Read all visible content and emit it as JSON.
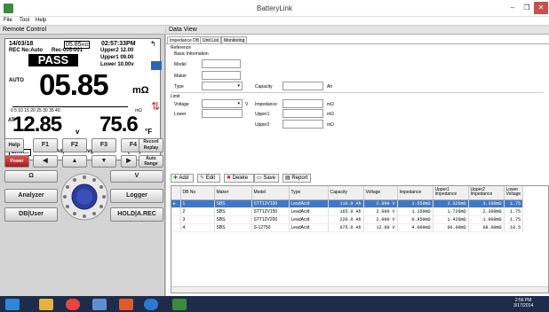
{
  "window": {
    "title": "BatteryLink",
    "min": "–",
    "max": "❐",
    "close": "✕"
  },
  "menu": [
    "File",
    "Tool",
    "Help"
  ],
  "left_header": "Remote Control",
  "right_header": "Data View",
  "lcd": {
    "date": "14/03/18",
    "range": "05.85",
    "range_unit": "mΩ",
    "time": "02:57:33PM",
    "rec": "REC No:Auto",
    "rec_num": "Rec-005-001",
    "pass": "PASS",
    "upper2": "Upper2 12.00",
    "upper1": "Upper1 09.00",
    "lower": "Lower 10.00v",
    "auto": "AUTO",
    "main_value": "05.85",
    "main_unit": "mΩ",
    "scale_labels": "0  5  10  15  20  25  30  35  40",
    "scale_unit": "mΩ",
    "at": "AT",
    "voltage": "12.85",
    "voltage_unit": "v",
    "temp": "75.6",
    "temp_unit": "°F",
    "bottom": [
      "Limit...",
      "0 Adj",
      "Avg Clear",
      "[Mm]Ω"
    ]
  },
  "buttons": {
    "help": "Help",
    "f1": "F1",
    "f2": "F2",
    "f3": "F3",
    "f4": "F4",
    "record": "Record\nReplay",
    "power": "Power",
    "auto_range": "Auto\nRange",
    "ohm": "Ω",
    "volt": "V",
    "analyzer": "Analyzer",
    "logger": "Logger",
    "db_user": "DB|User",
    "hold": "HOLD|A.REC"
  },
  "tabs": [
    "Impedance DB",
    "Unit List",
    "Monitoring"
  ],
  "form": {
    "reference": "Reference",
    "basic": "Basic Information",
    "model": "Model",
    "maker": "Maker",
    "type": "Type",
    "capacity": "Capacity",
    "capacity_unit": "Ah",
    "limit": "Limit",
    "voltage": "Voltage",
    "voltage_unit": "V",
    "lower": "Lower",
    "impedance": "Impedance",
    "upper1": "Upper1",
    "upper2": "Upper2",
    "mohm": "mΩ"
  },
  "toolbar": [
    "Add",
    "Edit",
    "Delete",
    "Save",
    "Report"
  ],
  "table": {
    "columns": [
      "",
      "DB No",
      "Maker",
      "Model",
      "Type",
      "Capacity",
      "Voltage",
      "Impedance",
      "Upper1\nImpedance",
      "Upper2\nImpedance",
      "Lower\nVoltage"
    ],
    "rows": [
      [
        "▸",
        "1",
        "SBS",
        "STT12V100",
        "LeadAcid",
        "110.0 Ah",
        "2.000 V",
        "1.550mΩ",
        "2.326mΩ",
        "3.100mΩ",
        "1.75"
      ],
      [
        "",
        "2",
        "SBS",
        "STT12V150",
        "LeadAcid",
        "165.0 Ah",
        "2.000 V",
        "1.150mΩ",
        "1.726mΩ",
        "2.300mΩ",
        "1.75"
      ],
      [
        "",
        "3",
        "SBS",
        "STT12V200",
        "LeadAcid",
        "220.0 Ah",
        "2.000 V",
        "0.950mΩ",
        "1.426mΩ",
        "1.900mΩ",
        "1.75"
      ],
      [
        "",
        "4",
        "SBS",
        "S-12750",
        "LeadAcid",
        "075.0 Ah",
        "12.00 V",
        "4.000mΩ",
        "06.00mΩ",
        "08.00mΩ",
        "10.5"
      ]
    ]
  },
  "taskbar": {
    "time": "2:56 PM",
    "date": "3/17/2014"
  }
}
